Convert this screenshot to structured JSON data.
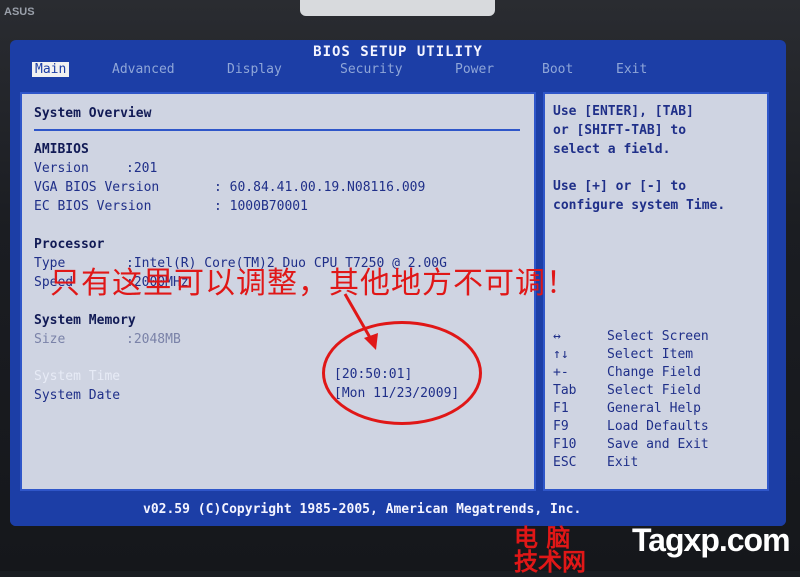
{
  "bezel": {
    "brand": "ASUS"
  },
  "bios": {
    "title": "BIOS SETUP UTILITY"
  },
  "menu": [
    {
      "label": "Main",
      "active": true
    },
    {
      "label": "Advanced"
    },
    {
      "label": "Display"
    },
    {
      "label": "Security"
    },
    {
      "label": "Power"
    },
    {
      "label": "Boot"
    },
    {
      "label": "Exit"
    }
  ],
  "overview": {
    "heading": "System Overview",
    "amibios": "AMIBIOS",
    "version_label": "Version",
    "version_value": ":201",
    "vga_label": "VGA BIOS Version",
    "vga_value": ": 60.84.41.00.19.N08116.009",
    "ec_label": "EC BIOS Version",
    "ec_value": ": 1000B70001",
    "processor": "Processor",
    "type_label": "Type",
    "type_value": ":Intel(R) Core(TM)2 Duo CPU T7250 @ 2.00G",
    "speed_label": "Speed",
    "speed_value": ":2000MHz",
    "memory": "System Memory",
    "size_label": "Size",
    "size_value": ":2048MB",
    "time_label": "System Time",
    "date_label": "System Date",
    "time_value": "[20:50:01]",
    "date_value": "[Mon 11/23/2009]"
  },
  "help": {
    "line1": "Use [ENTER], [TAB]",
    "line2": "or [SHIFT-TAB] to",
    "line3": "select a field.",
    "line4": "Use [+] or [-] to",
    "line5": "configure system Time.",
    "keys": [
      {
        "key": "↔",
        "desc": "Select Screen"
      },
      {
        "key": "↑↓",
        "desc": "Select Item"
      },
      {
        "key": "+-",
        "desc": "Change Field"
      },
      {
        "key": "Tab",
        "desc": "Select Field"
      },
      {
        "key": "F1",
        "desc": "General Help"
      },
      {
        "key": "F9",
        "desc": "Load Defaults"
      },
      {
        "key": "F10",
        "desc": "Save and Exit"
      },
      {
        "key": "ESC",
        "desc": "Exit"
      }
    ]
  },
  "footer": "v02.59 (C)Copyright 1985-2005, American Megatrends, Inc.",
  "annotation": "只有这里可以调整，其他地方不可调！",
  "watermark": {
    "line1": "电 脑",
    "line2": "技术网",
    "site": "Tagxp.com"
  },
  "colors": {
    "screen": "#1c3ea6",
    "panel": "#cfd4e2",
    "text": "#1f2f89",
    "annotation": "#e01717"
  }
}
